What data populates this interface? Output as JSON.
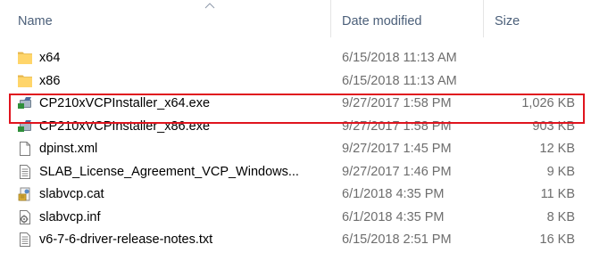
{
  "columns": {
    "name": "Name",
    "date_modified": "Date modified",
    "size": "Size"
  },
  "sort": {
    "column": "name",
    "icon": "sort-up-arrow-icon"
  },
  "highlight_color": "#e0141e",
  "files": [
    {
      "name": "x64",
      "date": "6/15/2018 11:13 AM",
      "size": "",
      "icon": "folder-icon"
    },
    {
      "name": "x86",
      "date": "6/15/2018 11:13 AM",
      "size": "",
      "icon": "folder-icon"
    },
    {
      "name": "CP210xVCPInstaller_x64.exe",
      "date": "9/27/2017 1:58 PM",
      "size": "1,026 KB",
      "icon": "installer-exe-icon",
      "highlighted": true
    },
    {
      "name": "CP210xVCPInstaller_x86.exe",
      "date": "9/27/2017 1:58 PM",
      "size": "903 KB",
      "icon": "installer-exe-icon"
    },
    {
      "name": "dpinst.xml",
      "date": "9/27/2017 1:45 PM",
      "size": "12 KB",
      "icon": "blank-file-icon"
    },
    {
      "name": "SLAB_License_Agreement_VCP_Windows...",
      "date": "9/27/2017 1:46 PM",
      "size": "9 KB",
      "icon": "text-file-icon"
    },
    {
      "name": "slabvcp.cat",
      "date": "6/1/2018 4:35 PM",
      "size": "11 KB",
      "icon": "security-catalog-icon"
    },
    {
      "name": "slabvcp.inf",
      "date": "6/1/2018 4:35 PM",
      "size": "8 KB",
      "icon": "setup-information-icon"
    },
    {
      "name": "v6-7-6-driver-release-notes.txt",
      "date": "6/15/2018 2:51 PM",
      "size": "16 KB",
      "icon": "text-file-icon"
    }
  ]
}
